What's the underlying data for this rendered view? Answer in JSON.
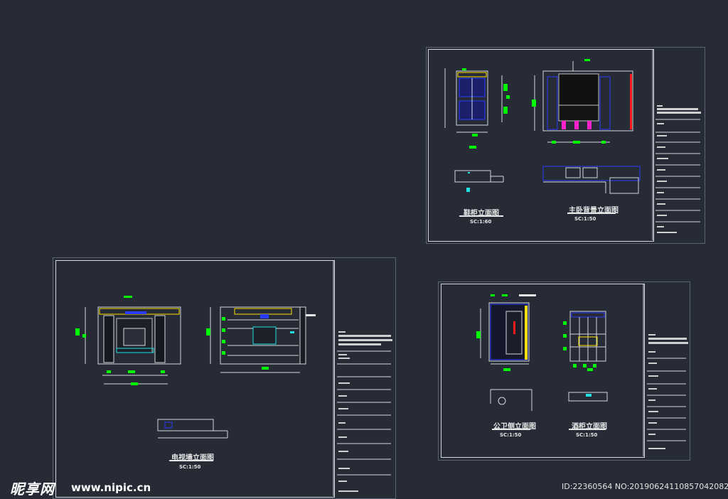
{
  "drawings": {
    "top_right": {
      "views": [
        {
          "title": "鞋柜立面图",
          "scale": "SC:1:60"
        },
        {
          "title": "主卧背景立面图",
          "scale": "SC:1:50"
        }
      ]
    },
    "bottom_left": {
      "views": [
        {
          "title": "电视墙立面图",
          "scale": "SC:1:50"
        }
      ]
    },
    "bottom_right": {
      "views": [
        {
          "title": "公卫侧立面图",
          "scale": "SC:1:50"
        },
        {
          "title": "酒柜立面图",
          "scale": "SC:1:50"
        }
      ]
    }
  },
  "watermark": {
    "brand": "昵享网",
    "url": "www.nipic.cn",
    "id_text": "ID:22360564 NO:20190624110857042082"
  },
  "colors": {
    "background": "#262b36",
    "line": "#d4d8de",
    "dimension_mark": "#00ff00",
    "accent_blue": "#2a3cff",
    "accent_red": "#ff1a1a",
    "accent_cyan": "#21e0e0",
    "accent_yellow": "#ffe000",
    "accent_magenta": "#ff22cc"
  }
}
